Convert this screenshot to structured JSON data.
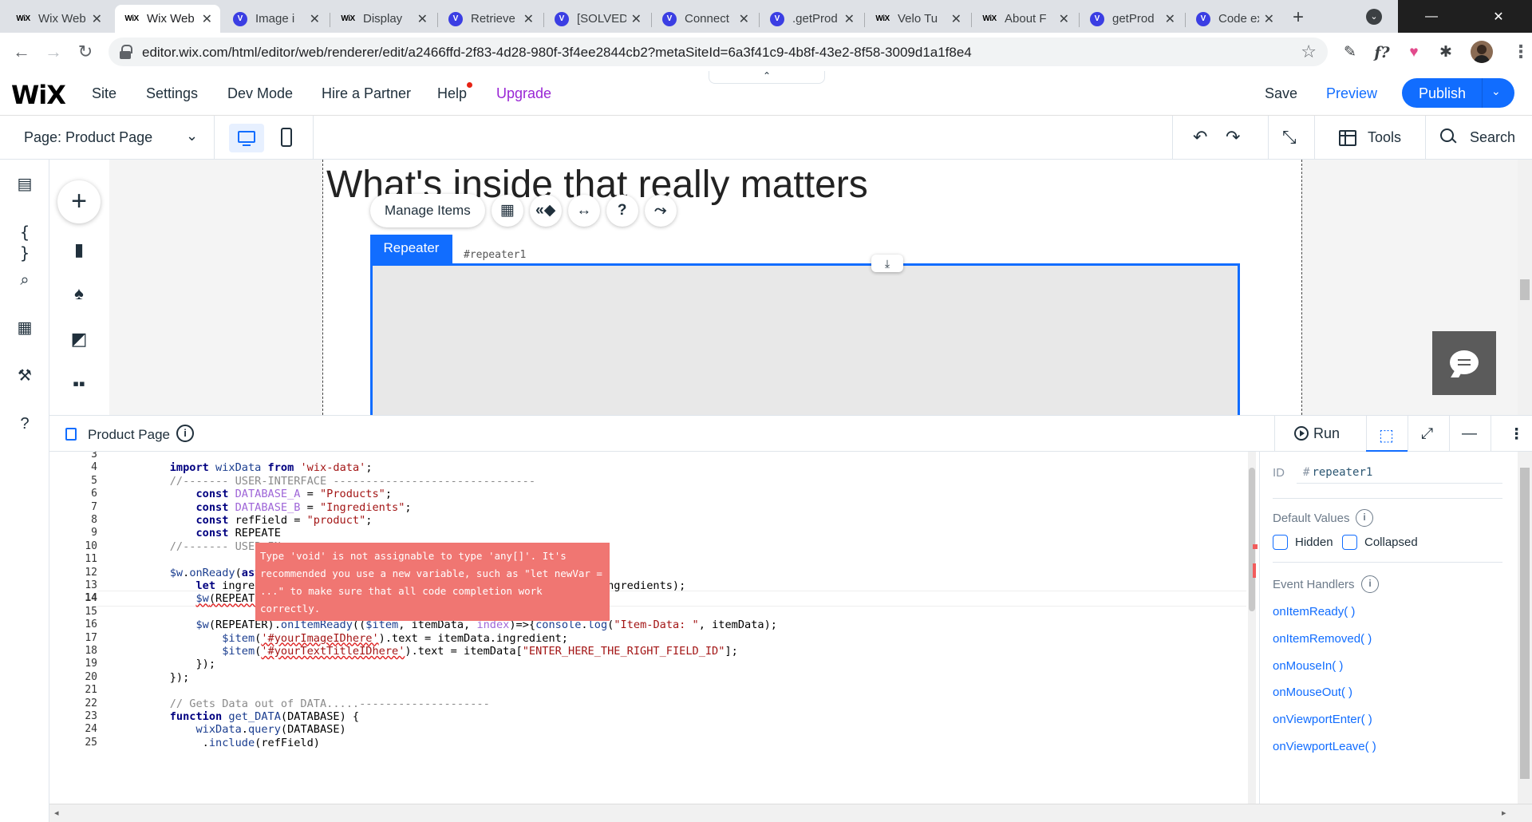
{
  "browser": {
    "tabs": [
      {
        "favicon": "wix",
        "title": "Wix Web",
        "active": false
      },
      {
        "favicon": "wix",
        "title": "Wix Web",
        "active": true
      },
      {
        "favicon": "velo",
        "title": "Image i",
        "active": false
      },
      {
        "favicon": "wix",
        "title": "Display",
        "active": false
      },
      {
        "favicon": "velo",
        "title": "Retrieve",
        "active": false
      },
      {
        "favicon": "velo",
        "title": "[SOLVED",
        "active": false
      },
      {
        "favicon": "velo",
        "title": "Connect",
        "active": false
      },
      {
        "favicon": "velo",
        "title": ".getProd",
        "active": false
      },
      {
        "favicon": "wix",
        "title": "Velo Tu",
        "active": false
      },
      {
        "favicon": "wix",
        "title": "About F",
        "active": false
      },
      {
        "favicon": "velo",
        "title": "getProd",
        "active": false
      },
      {
        "favicon": "velo",
        "title": "Code ex",
        "active": false
      }
    ],
    "wix_favicon_text": "WiX",
    "velo_favicon_text": "V",
    "close_glyph": "✕",
    "new_tab_glyph": "+",
    "url": "editor.wix.com/html/editor/web/renderer/edit/a2466ffd-2f83-4d28-980f-3f4ee2844cb2?metaSiteId=6a3f41c9-4b8f-43e2-8f58-3009d1a1f8e4"
  },
  "wix": {
    "logo": "WiX",
    "menu": [
      "Site",
      "Settings",
      "Dev Mode",
      "Hire a Partner",
      "Help",
      "Upgrade"
    ],
    "save": "Save",
    "preview": "Preview",
    "publish": "Publish",
    "page_selector": "Page: Product Page",
    "tools": "Tools",
    "search": "Search",
    "accent_color": "#116dff",
    "upgrade_color": "#9a27d5"
  },
  "canvas": {
    "section_title": "What's inside that really matters",
    "manage_items": "Manage Items",
    "repeater_label": "Repeater",
    "repeater_id": "#repeater1"
  },
  "code_panel": {
    "page_title": "Product Page",
    "run": "Run",
    "current_line": 14,
    "error_tooltip": "Type 'void' is not assignable to type 'any[]'. It's recommended you use a new variable, such as \"let newVar = ...\" to make sure that all code completion work correctly.",
    "lines": [
      {
        "n": 3,
        "text": ""
      },
      {
        "n": 4,
        "text": "    import wixData from 'wix-data';"
      },
      {
        "n": 5,
        "text": "    //------- USER-INTERFACE -------------------------------"
      },
      {
        "n": 6,
        "text": "        const DATABASE_A = \"Products\";"
      },
      {
        "n": 7,
        "text": "        const DATABASE_B = \"Ingredients\";"
      },
      {
        "n": 8,
        "text": "        const refField = \"product\";"
      },
      {
        "n": 9,
        "text": "        const REPEATE"
      },
      {
        "n": 10,
        "text": "    //------- USER-IN"
      },
      {
        "n": 11,
        "text": ""
      },
      {
        "n": 12,
        "text": "    $w.onReady(async"
      },
      {
        "n": 13,
        "text": "        let ingredien                                         nts: \", ingredients);"
      },
      {
        "n": 14,
        "text": "        $w(REPEATER).data = ingredients;"
      },
      {
        "n": 15,
        "text": ""
      },
      {
        "n": 16,
        "text": "        $w(REPEATER).onItemReady(($item, itemData, index)=>{console.log(\"Item-Data: \", itemData);"
      },
      {
        "n": 17,
        "text": "            $item('#yourImageIDhere').text = itemData.ingredient;"
      },
      {
        "n": 18,
        "text": "            $item('#yourTextTitleIDhere').text = itemData[\"ENTER_HERE_THE_RIGHT_FIELD_ID\"];"
      },
      {
        "n": 19,
        "text": "        });"
      },
      {
        "n": 20,
        "text": "    });"
      },
      {
        "n": 21,
        "text": ""
      },
      {
        "n": 22,
        "text": "    // Gets Data out of DATA.....--------------------"
      },
      {
        "n": 23,
        "text": "    function get_DATA(DATABASE) {"
      },
      {
        "n": 24,
        "text": "        wixData.query(DATABASE)"
      },
      {
        "n": 25,
        "text": "         .include(refField)"
      }
    ]
  },
  "properties": {
    "id_label": "ID",
    "id_hash": "#",
    "id_value": "repeater1",
    "default_values_heading": "Default Values",
    "hidden_label": "Hidden",
    "collapsed_label": "Collapsed",
    "event_handlers_heading": "Event Handlers",
    "handlers": [
      "onItemReady( )",
      "onItemRemoved( )",
      "onMouseIn( )",
      "onMouseOut( )",
      "onViewportEnter( )",
      "onViewportLeave( )"
    ]
  }
}
